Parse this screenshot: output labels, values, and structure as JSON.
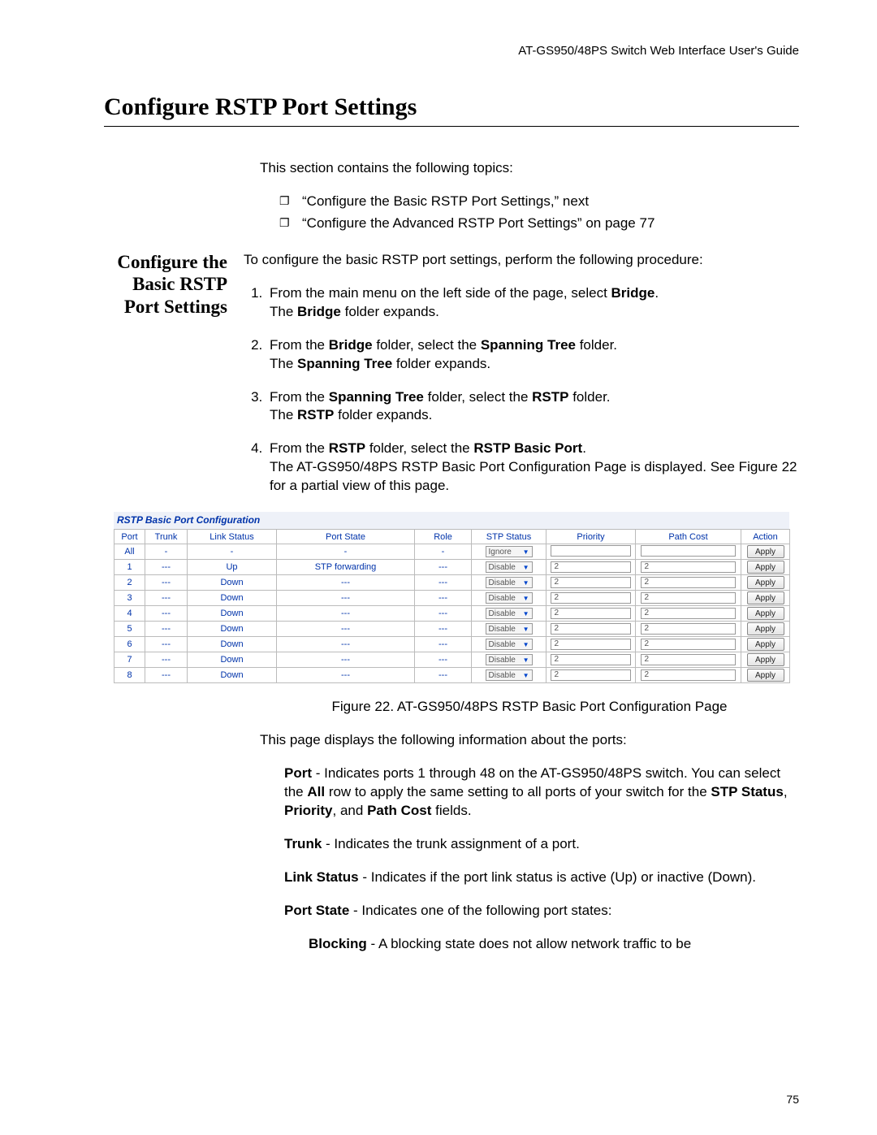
{
  "header": "AT-GS950/48PS Switch Web Interface User's Guide",
  "title": "Configure RSTP Port Settings",
  "intro_lead": "This section contains the following topics:",
  "topics": [
    "“Configure the Basic RSTP Port Settings,”  next",
    "“Configure the Advanced RSTP Port Settings” on page 77"
  ],
  "side_heading": "Configure the Basic RSTP Port Settings",
  "proc_lead": "To configure the basic RSTP port settings, perform the following procedure:",
  "steps": [
    {
      "pre": "From the main menu on the left side of the page, select ",
      "b1": "Bridge",
      "post1": ".",
      "line2a": "The ",
      "b2": "Bridge",
      "line2b": " folder expands."
    },
    {
      "pre": "From the ",
      "b1": "Bridge",
      "post1": " folder, select the ",
      "b2": "Spanning Tree",
      "post2": " folder.",
      "line2a": "The ",
      "b3": "Spanning Tree",
      "line2b": " folder expands."
    },
    {
      "pre": "From the ",
      "b1": "Spanning Tree",
      "post1": " folder, select the ",
      "b2": "RSTP",
      "post2": " folder.",
      "line2a": "The ",
      "b3": "RSTP",
      "line2b": " folder expands."
    },
    {
      "pre": "From the ",
      "b1": "RSTP",
      "post1": " folder, select the ",
      "b2": "RSTP Basic Port",
      "post2": ".",
      "line2": "The AT-GS950/48PS RSTP Basic Port Configuration Page is displayed. See Figure 22 for a partial view of this page."
    }
  ],
  "figure": {
    "bar_title": "RSTP Basic Port Configuration",
    "columns": [
      "Port",
      "Trunk",
      "Link Status",
      "Port State",
      "Role",
      "STP Status",
      "Priority",
      "Path Cost",
      "Action"
    ],
    "rows": [
      {
        "port": "All",
        "trunk": "-",
        "link": "-",
        "state": "-",
        "role": "-",
        "stp": "Ignore",
        "pri": "",
        "pc": "",
        "action": "Apply"
      },
      {
        "port": "1",
        "trunk": "---",
        "link": "Up",
        "state": "STP forwarding",
        "role": "---",
        "stp": "Disable",
        "pri": "2",
        "pc": "2",
        "action": "Apply"
      },
      {
        "port": "2",
        "trunk": "---",
        "link": "Down",
        "state": "---",
        "role": "---",
        "stp": "Disable",
        "pri": "2",
        "pc": "2",
        "action": "Apply"
      },
      {
        "port": "3",
        "trunk": "---",
        "link": "Down",
        "state": "---",
        "role": "---",
        "stp": "Disable",
        "pri": "2",
        "pc": "2",
        "action": "Apply"
      },
      {
        "port": "4",
        "trunk": "---",
        "link": "Down",
        "state": "---",
        "role": "---",
        "stp": "Disable",
        "pri": "2",
        "pc": "2",
        "action": "Apply"
      },
      {
        "port": "5",
        "trunk": "---",
        "link": "Down",
        "state": "---",
        "role": "---",
        "stp": "Disable",
        "pri": "2",
        "pc": "2",
        "action": "Apply"
      },
      {
        "port": "6",
        "trunk": "---",
        "link": "Down",
        "state": "---",
        "role": "---",
        "stp": "Disable",
        "pri": "2",
        "pc": "2",
        "action": "Apply"
      },
      {
        "port": "7",
        "trunk": "---",
        "link": "Down",
        "state": "---",
        "role": "---",
        "stp": "Disable",
        "pri": "2",
        "pc": "2",
        "action": "Apply"
      },
      {
        "port": "8",
        "trunk": "---",
        "link": "Down",
        "state": "---",
        "role": "---",
        "stp": "Disable",
        "pri": "2",
        "pc": "2",
        "action": "Apply"
      }
    ],
    "caption": "Figure 22. AT-GS950/48PS RSTP Basic Port Configuration Page"
  },
  "after_fig_lead": "This page displays the following information about the ports:",
  "defs": {
    "port": {
      "t": "Port",
      "d": " - Indicates ports 1 through 48 on the AT-GS950/48PS switch. You can select the ",
      "b1": "All",
      "d2": " row to apply the same setting to all ports of your switch for the ",
      "b2": "STP Status",
      "d3": ", ",
      "b3": "Priority",
      "d4": ", and ",
      "b4": "Path Cost",
      "d5": " fields."
    },
    "trunk": {
      "t": "Trunk",
      "d": " - Indicates the trunk assignment of a port."
    },
    "link": {
      "t": "Link Status",
      "d": " - Indicates if the port link status is active (Up) or inactive (Down)."
    },
    "state": {
      "t": "Port State",
      "d": " - Indicates one of the following port states:"
    },
    "blocking": {
      "t": "Blocking",
      "d": " - A blocking state does not allow network traffic to be"
    }
  },
  "page_number": "75"
}
